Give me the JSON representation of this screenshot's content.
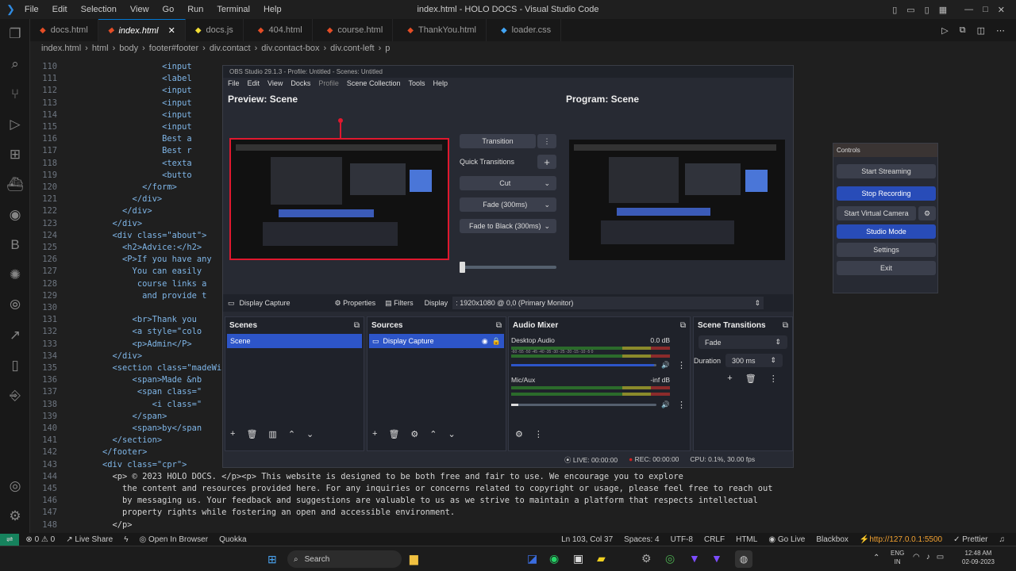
{
  "vscode": {
    "menu": [
      "File",
      "Edit",
      "Selection",
      "View",
      "Go",
      "Run",
      "Terminal",
      "Help"
    ],
    "window_title": "index.html - HOLO DOCS - Visual Studio Code",
    "tabs": [
      {
        "label": "docs.html",
        "icon": "html-icon",
        "active": false
      },
      {
        "label": "index.html",
        "icon": "html-icon",
        "active": true
      },
      {
        "label": "docs.js",
        "icon": "js-icon",
        "active": false
      },
      {
        "label": "404.html",
        "icon": "html-icon",
        "active": false
      },
      {
        "label": "course.html",
        "icon": "html-icon",
        "active": false
      },
      {
        "label": "ThankYou.html",
        "icon": "html-icon",
        "active": false
      },
      {
        "label": "loader.css",
        "icon": "css-icon",
        "active": false
      }
    ],
    "breadcrumb": [
      "index.html",
      "html",
      "body",
      "footer#footer",
      "div.contact",
      "div.contact-box",
      "div.cont-left",
      "p"
    ],
    "code_lines": [
      {
        "n": "110",
        "text": "                <input"
      },
      {
        "n": "111",
        "text": "                <label"
      },
      {
        "n": "112",
        "text": "                <input"
      },
      {
        "n": "113",
        "text": "                <input"
      },
      {
        "n": "114",
        "text": "                <input"
      },
      {
        "n": "115",
        "text": "                <input"
      },
      {
        "n": "116",
        "text": "                Best a"
      },
      {
        "n": "117",
        "text": "                Best r"
      },
      {
        "n": "118",
        "text": "                <texta"
      },
      {
        "n": "119",
        "text": "                <butto"
      },
      {
        "n": "120",
        "text": "            </form>"
      },
      {
        "n": "121",
        "text": "          </div>"
      },
      {
        "n": "122",
        "text": "        </div>"
      },
      {
        "n": "123",
        "text": "      </div>"
      },
      {
        "n": "124",
        "text": "      <div class=\"about\">"
      },
      {
        "n": "125",
        "text": "        <h2>Advice:</h2>"
      },
      {
        "n": "126",
        "text": "        <P>If you have any"
      },
      {
        "n": "127",
        "text": "          You can easily"
      },
      {
        "n": "128",
        "text": "           course links a"
      },
      {
        "n": "129",
        "text": "            and provide t"
      },
      {
        "n": "130",
        "text": ""
      },
      {
        "n": "131",
        "text": "          <br>Thank you"
      },
      {
        "n": "132",
        "text": "          <a style=\"colo"
      },
      {
        "n": "133",
        "text": "          <p>Admin</P>"
      },
      {
        "n": "134",
        "text": "      </div>"
      },
      {
        "n": "135",
        "text": "      <section class=\"madeWi"
      },
      {
        "n": "136",
        "text": "          <span>Made &nb"
      },
      {
        "n": "137",
        "text": "           <span class=\""
      },
      {
        "n": "138",
        "text": "              <i class=\""
      },
      {
        "n": "139",
        "text": "          </span>"
      },
      {
        "n": "140",
        "text": "          <span>by</span"
      },
      {
        "n": "141",
        "text": "      </section>"
      },
      {
        "n": "142",
        "text": "    </footer>"
      },
      {
        "n": "143",
        "text": "    <div class=\"cpr\">"
      },
      {
        "n": "144",
        "text": "      <p> © 2023 HOLO DOCS. </p><p> This website is designed to be both free and fair to use. We encourage you to explore"
      },
      {
        "n": "145",
        "text": "        the content and resources provided here. For any inquiries or concerns related to copyright or usage, please feel free to reach out"
      },
      {
        "n": "146",
        "text": "        by messaging us. Your feedback and suggestions are valuable to us as we strive to maintain a platform that respects intellectual"
      },
      {
        "n": "147",
        "text": "        property rights while fostering an open and accessible environment."
      },
      {
        "n": "148",
        "text": "      </p>"
      }
    ],
    "status": {
      "errors": "0",
      "warnings": "0",
      "live_share": "Live Share",
      "open_browser": "Open In Browser",
      "quokka": "Quokka",
      "position": "Ln 103, Col 37",
      "spaces": "Spaces: 4",
      "encoding": "UTF-8",
      "eol": "CRLF",
      "lang": "HTML",
      "go_live": "Go Live",
      "blackbox": "Blackbox",
      "server": "http://127.0.0.1:5500",
      "prettier": "Prettier"
    }
  },
  "obs": {
    "title": "OBS Studio 29.1.3 - Profile: Untitled - Scenes: Untitled",
    "menu": [
      "File",
      "Edit",
      "View",
      "Docks",
      "Profile",
      "Scene Collection",
      "Tools",
      "Help"
    ],
    "preview_label": "Preview: Scene",
    "program_label": "Program: Scene",
    "transition_btn": "Transition",
    "quick_transitions": "Quick Transitions",
    "qt_items": [
      "Cut",
      "Fade (300ms)",
      "Fade to Black (300ms)"
    ],
    "source_bar": {
      "source": "Display Capture",
      "properties": "Properties",
      "filters": "Filters",
      "display_label": "Display",
      "display_value": ": 1920x1080 @ 0,0 (Primary Monitor)"
    },
    "scenes": {
      "header": "Scenes",
      "items": [
        "Scene"
      ]
    },
    "sources": {
      "header": "Sources",
      "items": [
        "Display Capture"
      ]
    },
    "mixer": {
      "header": "Audio Mixer",
      "tracks": [
        {
          "name": "Desktop Audio",
          "db": "0.0 dB",
          "level": 0.98
        },
        {
          "name": "Mic/Aux",
          "db": "-inf dB",
          "level": 0.05
        }
      ],
      "scale": "-60 -55 -50 -45 -40 -35 -30 -25 -20 -15 -10 -5 0"
    },
    "transitions": {
      "header": "Scene Transitions",
      "value": "Fade",
      "duration_label": "Duration",
      "duration_value": "300 ms"
    },
    "status": {
      "live": "LIVE: 00:00:00",
      "rec": "REC: 00:00:00",
      "cpu": "CPU: 0.1%, 30.00 fps"
    }
  },
  "controls": {
    "header": "Controls",
    "buttons": [
      "Start Streaming",
      "Stop Recording",
      "Start Virtual Camera",
      "Studio Mode",
      "Settings",
      "Exit"
    ]
  },
  "taskbar": {
    "search": "Search",
    "lang1": "ENG",
    "lang2": "IN",
    "time": "12:48 AM",
    "date": "02-09-2023"
  },
  "colors": {
    "accent": "#284cb8",
    "selection": "#2d55c8",
    "red_bounds": "#e0182e",
    "rec": "#d02020"
  }
}
